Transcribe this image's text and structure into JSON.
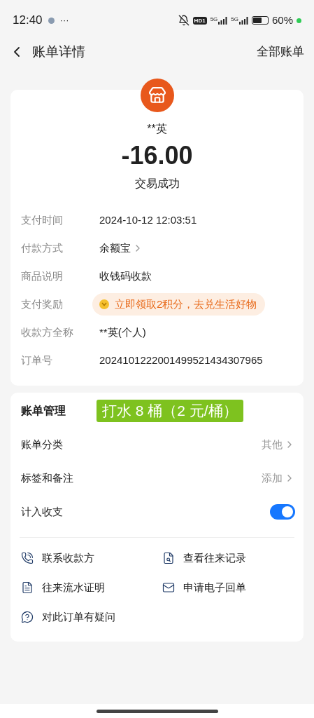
{
  "status_bar": {
    "time": "12:40",
    "dots": "···",
    "hd": "HD1",
    "networks": [
      "5G",
      "5G"
    ],
    "battery": "60%"
  },
  "header": {
    "title": "账单详情",
    "action": "全部账单"
  },
  "summary": {
    "payee": "**英",
    "amount": "-16.00",
    "status": "交易成功"
  },
  "details": [
    {
      "kind": "text",
      "label": "支付时间",
      "value": "2024-10-12 12:03:51"
    },
    {
      "kind": "link",
      "label": "付款方式",
      "value": "余额宝"
    },
    {
      "kind": "text",
      "label": "商品说明",
      "value": "收钱码收款"
    },
    {
      "kind": "reward",
      "label": "支付奖励",
      "value": "立即领取2积分，去兑生活好物"
    },
    {
      "kind": "text",
      "label": "收款方全称",
      "value": "**英(个人)"
    },
    {
      "kind": "text",
      "label": "订单号",
      "value": "2024101222001499521434307965"
    }
  ],
  "management": {
    "title": "账单管理",
    "note": "打水 8 桶（2 元/桶）",
    "rows": [
      {
        "kind": "link",
        "label": "账单分类",
        "value": "其他"
      },
      {
        "kind": "link",
        "label": "标签和备注",
        "value": "添加"
      },
      {
        "kind": "toggle",
        "label": "计入收支",
        "on": true
      }
    ],
    "actions": [
      {
        "kind": "contact",
        "label": "联系收款方"
      },
      {
        "kind": "records",
        "label": "查看往来记录"
      },
      {
        "kind": "statement",
        "label": "往来流水证明"
      },
      {
        "kind": "mail",
        "label": "申请电子回单"
      },
      {
        "kind": "question",
        "label": "对此订单有疑问"
      }
    ]
  }
}
